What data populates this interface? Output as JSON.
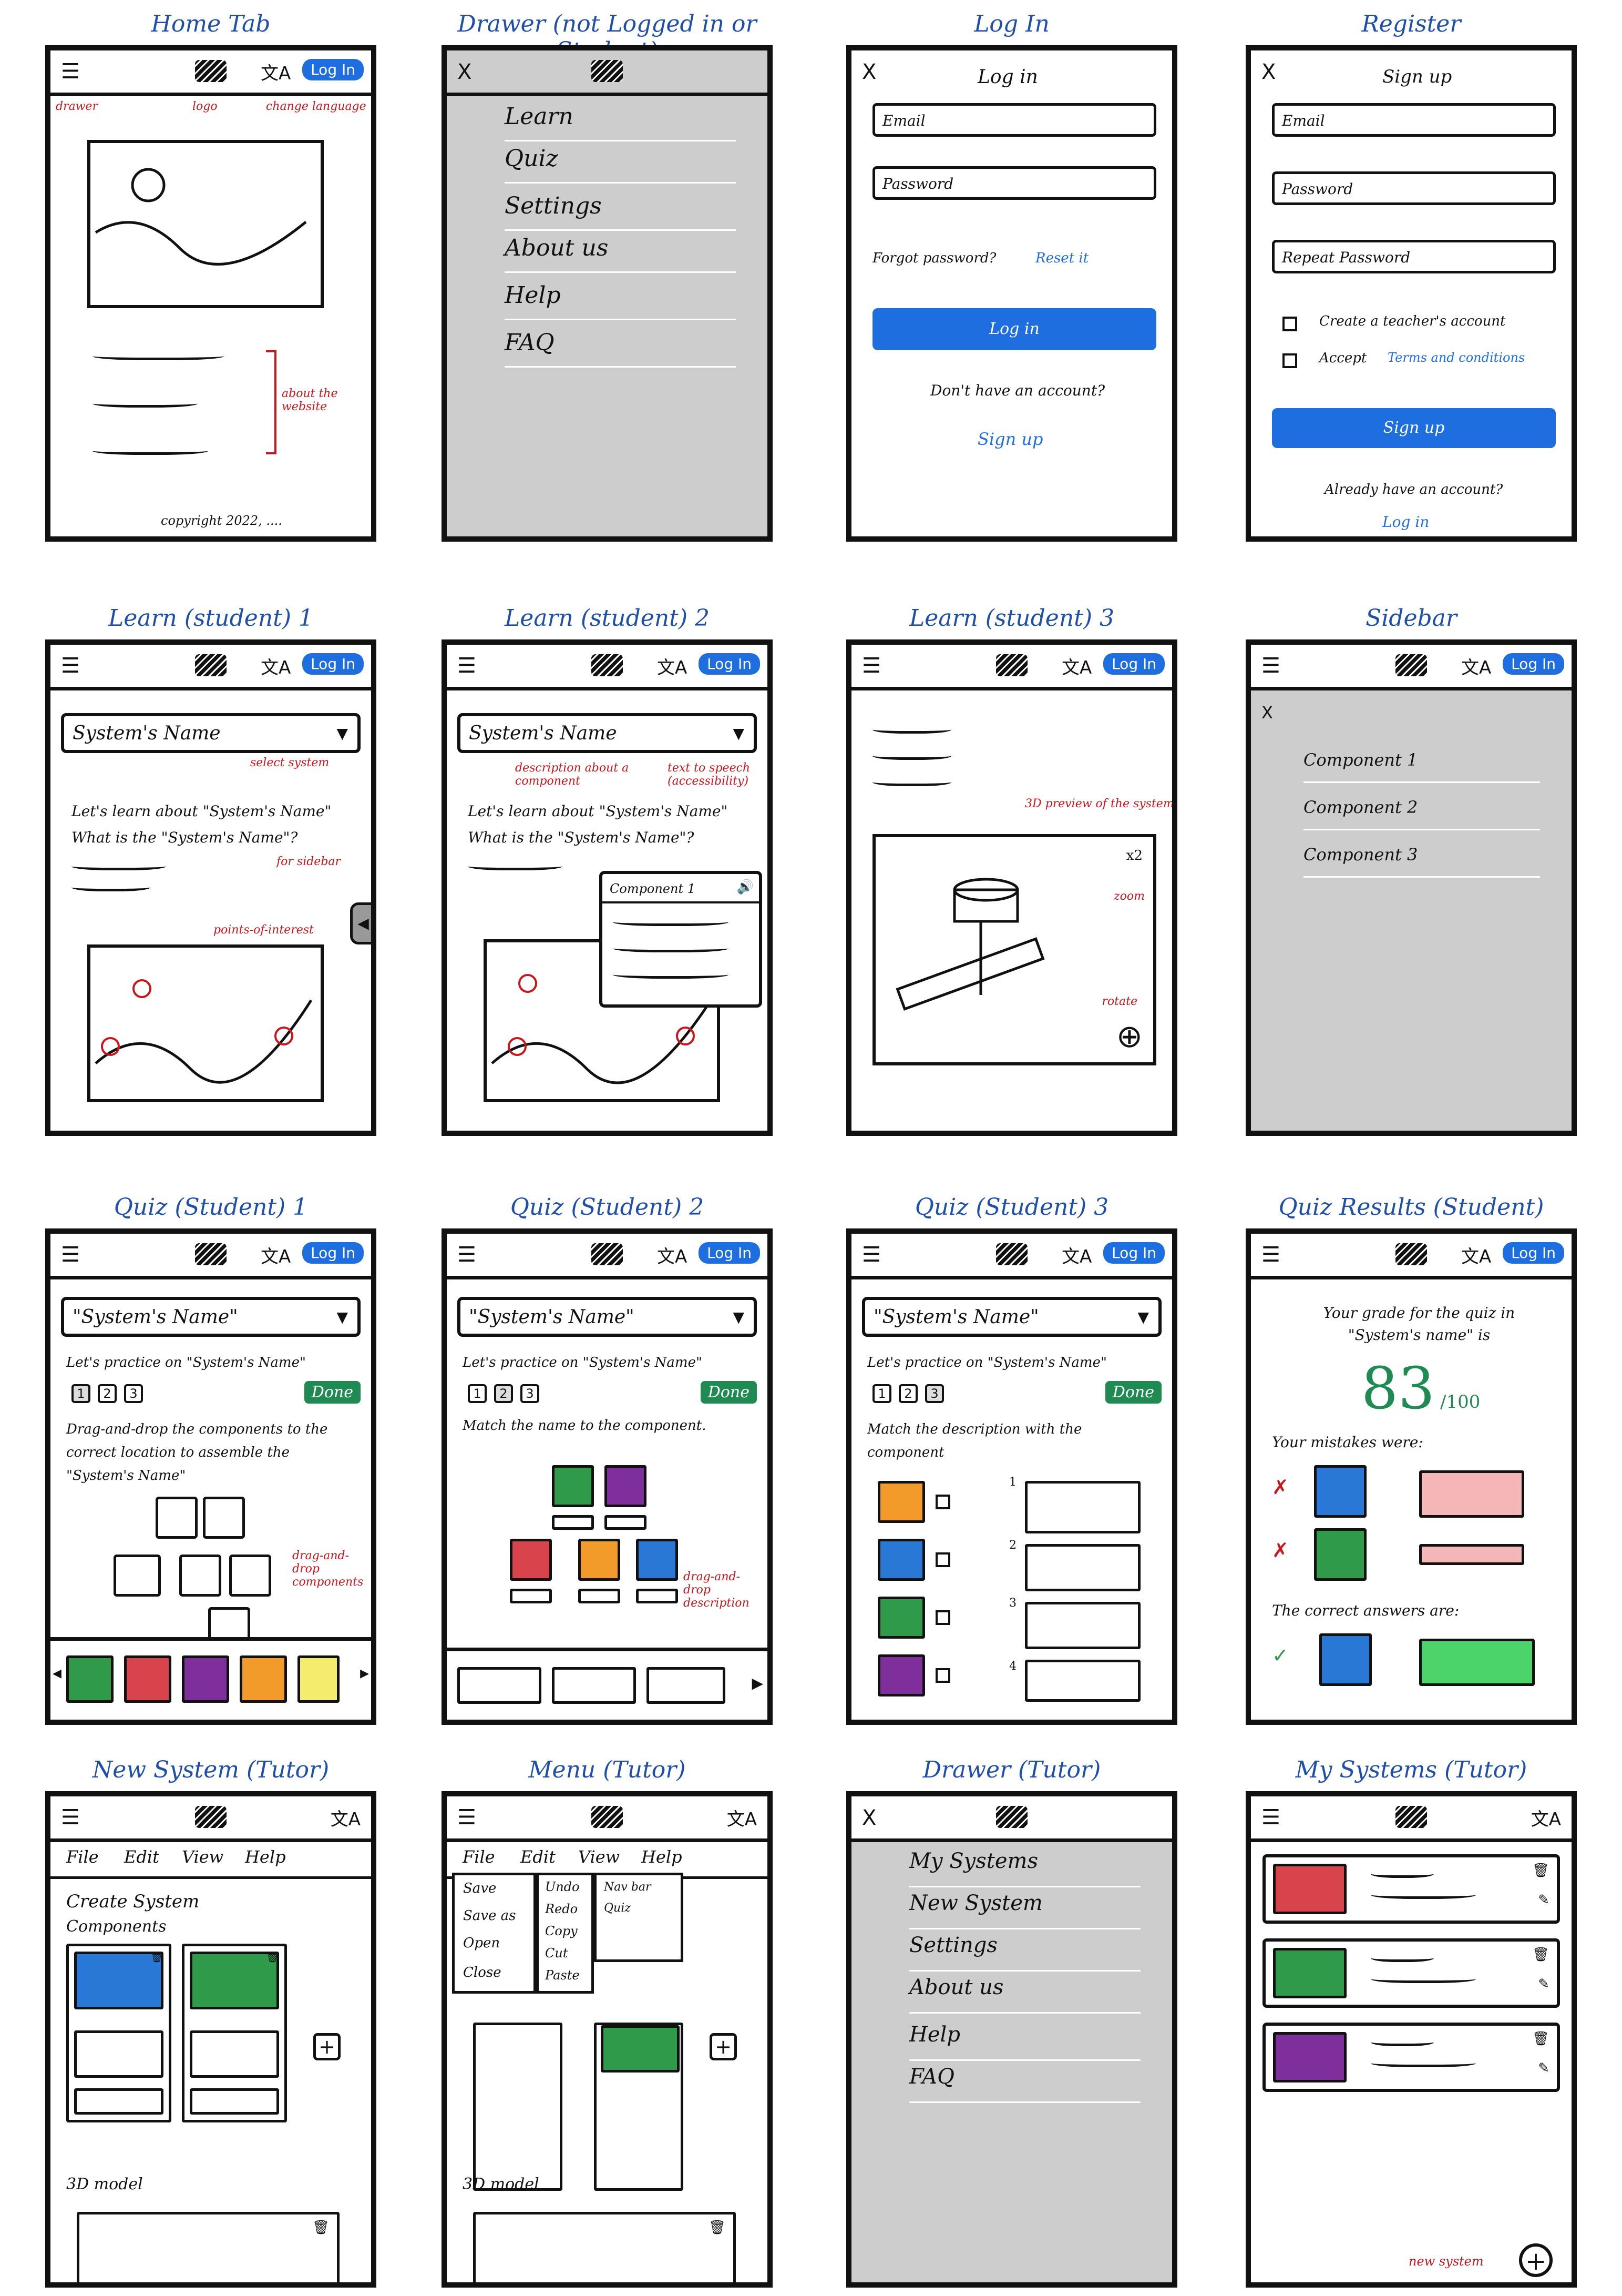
{
  "colors": {
    "accent": "#1e6ee0",
    "annotation": "#c8161d",
    "title": "#1f4fa8",
    "grade": "#1f8a52"
  },
  "common": {
    "login": "Log In",
    "lang_icon": "translate-icon",
    "logo_icon": "logo-icon",
    "menu_icon": "hamburger-icon",
    "close": "X",
    "drawer": "drawer",
    "logo": "logo",
    "change_language": "change language",
    "done": "Done",
    "n1": "1",
    "n2": "2",
    "n3": "3",
    "n4": "4",
    "system_name_q": "\"System's Name\"",
    "system_name": "System's Name"
  },
  "screens": {
    "home": {
      "title": "Home Tab",
      "about": "about the website",
      "copyright": "copyright 2022, ...."
    },
    "drawer": {
      "title": "Drawer (not Logged in or Student)",
      "items": [
        "Learn",
        "Quiz",
        "Settings",
        "About us",
        "Help",
        "FAQ"
      ]
    },
    "login": {
      "title": "Log In",
      "heading": "Log in",
      "email": "Email",
      "password": "Password",
      "forgot": "Forgot password?",
      "reset": "Reset it",
      "button": "Log in",
      "no_account": "Don't have an account?",
      "signup": "Sign up"
    },
    "register": {
      "title": "Register",
      "heading": "Sign up",
      "email": "Email",
      "password": "Password",
      "repeat": "Repeat Password",
      "teacher": "Create a teacher's account",
      "accept": "Accept",
      "terms": "Terms and conditions",
      "button": "Sign up",
      "have_account": "Already have an account?",
      "login": "Log in"
    },
    "learn1": {
      "title": "Learn (student) 1",
      "select_note": "select system",
      "intro": "Let's learn about \"System's Name\"",
      "question": "What is the \"System's Name\"?",
      "sidebar_note": "for sidebar",
      "poi_note": "points-of-interest"
    },
    "learn2": {
      "title": "Learn (student) 2",
      "desc_note": "description about a component",
      "tts_note": "text to speech (accessibility)",
      "intro": "Let's learn about \"System's Name\"",
      "question": "What is the \"System's Name\"?",
      "component": "Component 1"
    },
    "learn3": {
      "title": "Learn (student) 3",
      "preview_note": "3D preview of the system",
      "zoom": "x2",
      "zoom_note": "zoom",
      "rotate_note": "rotate"
    },
    "sidebar": {
      "title": "Sidebar",
      "items": [
        "Component 1",
        "Component 2",
        "Component 3"
      ]
    },
    "quiz1": {
      "title": "Quiz (Student) 1",
      "practice": "Let's practice on \"System's Name\"",
      "instructions": "Drag-and-drop the components to the correct location to assemble the \"System's Name\"",
      "dnd_note": "drag-and-drop components"
    },
    "quiz2": {
      "title": "Quiz (Student) 2",
      "practice": "Let's practice on \"System's Name\"",
      "instructions": "Match the name to the component.",
      "dnd_note": "drag-and-drop description"
    },
    "quiz3": {
      "title": "Quiz (Student) 3",
      "practice": "Let's practice on \"System's Name\"",
      "instructions": "Match the description with the component"
    },
    "results": {
      "title": "Quiz Results (Student)",
      "grade_text": "Your grade for the quiz in \"System's name\" is",
      "score": "83",
      "score_max": "/100",
      "mistakes": "Your mistakes were:",
      "correct": "The correct answers are:",
      "wrong_mark": "✗",
      "right_mark": "✓"
    },
    "newsystem": {
      "title": "New System (Tutor)",
      "menu": [
        "File",
        "Edit",
        "View",
        "Help"
      ],
      "create": "Create System",
      "components": "Components",
      "model": "3D model",
      "plus": "+"
    },
    "menututor": {
      "title": "Menu (Tutor)",
      "menu": [
        "File",
        "Edit",
        "View",
        "Help"
      ],
      "file": [
        "Save",
        "Save as",
        "Open",
        "Close"
      ],
      "edit": [
        "Undo",
        "Redo",
        "Copy",
        "Cut",
        "Paste"
      ],
      "view": [
        "Nav bar",
        "Quiz"
      ],
      "model": "3D model",
      "plus": "+"
    },
    "drawertutor": {
      "title": "Drawer (Tutor)",
      "items": [
        "My Systems",
        "New System",
        "Settings",
        "About us",
        "Help",
        "FAQ"
      ]
    },
    "mysystems": {
      "title": "My Systems (Tutor)",
      "new_note": "new system",
      "plus": "+"
    }
  }
}
